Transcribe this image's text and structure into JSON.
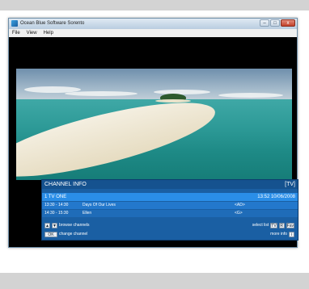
{
  "window": {
    "title": "Ocean Blue Software Sorento",
    "buttons": {
      "minimize": "–",
      "maximize": "□",
      "close": "x"
    },
    "menu": [
      "File",
      "View",
      "Help"
    ]
  },
  "osd": {
    "title": "CHANNEL INFO",
    "type": "[TV]",
    "channel": {
      "name": "1  TV ONE",
      "datetime": "13:52 10/06/2008"
    },
    "programmes": [
      {
        "time": "13:30 - 14:30",
        "name": "Days Of Our Lives",
        "flags": "<AD>"
      },
      {
        "time": "14:30 - 15:30",
        "name": "Ellen",
        "flags": "<G>"
      }
    ],
    "controls": {
      "browse_label": "browse channels",
      "change_key": "OK",
      "change_label": "change channel",
      "select_label": "select list",
      "list_keys": [
        "TV",
        "R",
        "Fav"
      ],
      "more_label": "more info",
      "more_key": "i",
      "extra_text": "channel..."
    }
  },
  "colors": {
    "osd_bg": "#1a5fa3",
    "osd_highlight": "#2a8ee8",
    "sea": "#2d9a97",
    "window_black": "#000000"
  }
}
